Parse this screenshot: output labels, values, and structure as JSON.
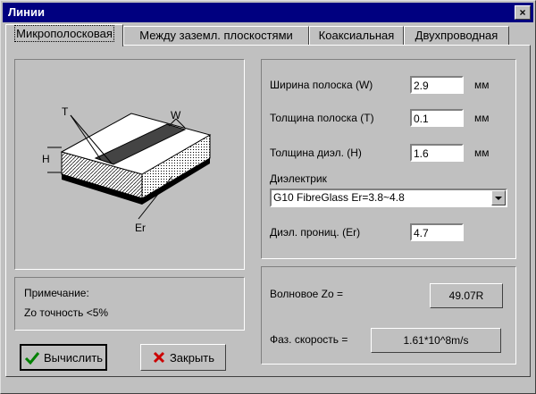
{
  "window": {
    "title": "Линии",
    "close_glyph": "×"
  },
  "tabs": [
    {
      "label": "Микрополосковая",
      "active": true
    },
    {
      "label": "Между заземл. плоскостями",
      "active": false
    },
    {
      "label": "Коаксиальная",
      "active": false
    },
    {
      "label": "Двухпроводная",
      "active": false
    }
  ],
  "diagram": {
    "labels": {
      "t": "T",
      "w": "W",
      "h": "H",
      "er": "Er"
    }
  },
  "note": {
    "title": "Примечание:",
    "text": "Zo точность <5%"
  },
  "params": {
    "width": {
      "label": "Ширина полоска (W)",
      "value": "2.9",
      "unit": "мм"
    },
    "thickness": {
      "label": "Толщина полоска (T)",
      "value": "0.1",
      "unit": "мм"
    },
    "dielectric_thickness": {
      "label": "Толщина диэл. (H)",
      "value": "1.6",
      "unit": "мм"
    },
    "dielectric": {
      "label": "Диэлектрик",
      "selected": "G10 FibreGlass Er=3.8~4.8"
    },
    "permittivity": {
      "label": "Диэл. прониц. (Er)",
      "value": "4.7"
    }
  },
  "results": {
    "impedance": {
      "label": "Волновое Zo =",
      "value": "49.07R"
    },
    "velocity": {
      "label": "Фаз. скорость =",
      "value": "1.61*10^8m/s"
    }
  },
  "buttons": {
    "calculate": "Вычислить",
    "close": "Закрыть"
  },
  "colors": {
    "titlebar": "#000080",
    "face": "#c0c0c0",
    "check": "#008000",
    "cross": "#cc0000"
  }
}
